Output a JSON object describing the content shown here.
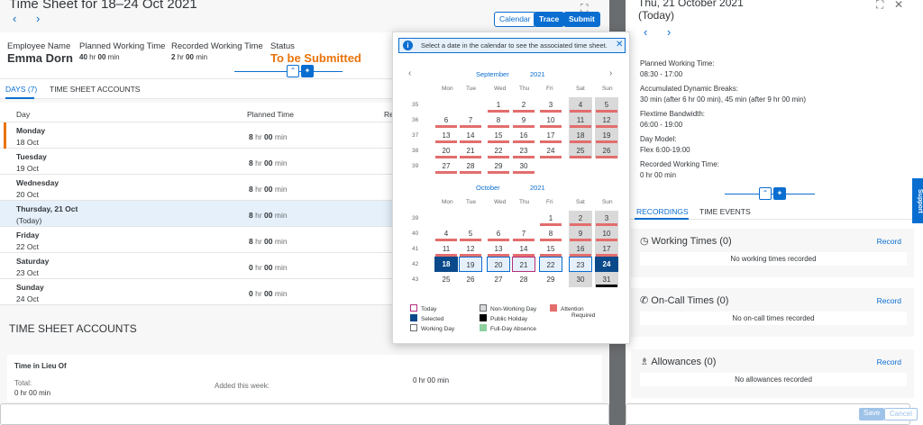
{
  "left": {
    "title": "Time Sheet for 18–24 Oct 2021",
    "nav_prev": "‹",
    "nav_next": "›",
    "expand_icon": "⛶",
    "buttons": {
      "calendar": "Calendar",
      "trace": "Trace",
      "submit": "Submit"
    },
    "header": {
      "employee_label": "Employee Name",
      "employee_name": "Emma Dorn",
      "planned_label": "Planned Working Time",
      "planned_hr": "40",
      "planned_min": "00",
      "recorded_label": "Recorded Working Time",
      "recorded_hr": "2",
      "recorded_min": "00",
      "status_label": "Status",
      "status_value": "To be Submitted",
      "collapse_icon": "⌃",
      "pin_icon": "📌"
    },
    "tabs": {
      "days": "DAYS (7)",
      "accounts": "TIME SHEET ACCOUNTS"
    },
    "table": {
      "col_day": "Day",
      "col_planned": "Planned Time",
      "col_recorded_partial": "Re",
      "hr_unit": "hr",
      "min_unit": "min",
      "rows": [
        {
          "name": "Monday",
          "date": "18 Oct",
          "hr": "8",
          "min": "00"
        },
        {
          "name": "Tuesday",
          "date": "19 Oct",
          "hr": "8",
          "min": "00"
        },
        {
          "name": "Wednesday",
          "date": "20 Oct",
          "hr": "8",
          "min": "00"
        },
        {
          "name": "Thursday, 21 Oct",
          "date": "(Today)",
          "hr": "8",
          "min": "00"
        },
        {
          "name": "Friday",
          "date": "22 Oct",
          "hr": "8",
          "min": "00"
        },
        {
          "name": "Saturday",
          "date": "23 Oct",
          "hr": "0",
          "min": "00"
        },
        {
          "name": "Sunday",
          "date": "24 Oct",
          "hr": "0",
          "min": "00"
        }
      ]
    },
    "accounts": {
      "title": "TIME SHEET ACCOUNTS",
      "til_title": "Time in Lieu Of",
      "total_label": "Total:",
      "total_value": "0 hr 00 min",
      "added_label": "Added this week:",
      "added_value": "0 hr 00 min"
    }
  },
  "right": {
    "title_line1": "Thu, 21 October 2021",
    "title_line2": "(Today)",
    "nav_prev": "‹",
    "nav_next": "›",
    "icons": {
      "expand": "⛶",
      "close": "✕"
    },
    "planned_label": "Planned Working Time:",
    "planned_value": "08:30 - 17:00",
    "breaks_label": "Accumulated Dynamic Breaks:",
    "breaks_value": "30 min (after 6 hr 00 min), 45 min (after 9 hr 00 min)",
    "flex_label": "Flextime Bandwidth:",
    "flex_value": "06:00 - 19:00",
    "model_label": "Day Model:",
    "model_value": "Flex 6:00-19:00",
    "recorded_label": "Recorded Working Time:",
    "recorded_value": "0 hr 00 min",
    "collapse_icon": "⌃",
    "pin_icon": "📌",
    "tabs": {
      "recordings": "RECORDINGS",
      "events": "TIME EVENTS"
    },
    "sections": [
      {
        "icon": "◷",
        "title": "Working Times (0)",
        "record": "Record",
        "empty": "No working times recorded"
      },
      {
        "icon": "✆",
        "title": "On-Call Times (0)",
        "record": "Record",
        "empty": "No on-call times recorded"
      },
      {
        "icon": "♗",
        "title": "Allowances (0)",
        "record": "Record",
        "empty": "No allowances recorded"
      }
    ],
    "support": "Support",
    "footer": {
      "save": "Save",
      "cancel": "Cancel"
    }
  },
  "popover": {
    "info_icon": "i",
    "info_text": "Select a date in the calendar to see the associated time sheet.",
    "info_close": "✕",
    "prev_icon": "‹",
    "next_icon": "›",
    "weekdays": [
      "Mon",
      "Tue",
      "Wed",
      "Thu",
      "Fri",
      "Sat",
      "Sun"
    ],
    "september": {
      "month": "September",
      "year": "2021",
      "weeks": [
        "35",
        "36",
        "37",
        "38",
        "39"
      ],
      "rows": [
        [
          "",
          "",
          "1",
          "2",
          "3",
          "4",
          "5"
        ],
        [
          "6",
          "7",
          "8",
          "9",
          "10",
          "11",
          "12"
        ],
        [
          "13",
          "14",
          "15",
          "16",
          "17",
          "18",
          "19"
        ],
        [
          "20",
          "21",
          "22",
          "23",
          "24",
          "25",
          "26"
        ],
        [
          "27",
          "28",
          "29",
          "30",
          "",
          "",
          ""
        ]
      ]
    },
    "october": {
      "month": "October",
      "year": "2021",
      "weeks": [
        "39",
        "40",
        "41",
        "42",
        "43"
      ],
      "rows": [
        [
          "",
          "",
          "",
          "",
          "1",
          "2",
          "3"
        ],
        [
          "4",
          "5",
          "6",
          "7",
          "8",
          "9",
          "10"
        ],
        [
          "11",
          "12",
          "13",
          "14",
          "15",
          "16",
          "17"
        ],
        [
          "18",
          "19",
          "20",
          "21",
          "22",
          "23",
          "24"
        ],
        [
          "25",
          "26",
          "27",
          "28",
          "29",
          "30",
          "31"
        ]
      ]
    },
    "legend": {
      "today": "Today",
      "selected": "Selected",
      "working": "Working Day",
      "nonworking": "Non-Working Day",
      "holiday": "Public Holiday",
      "absence": "Full-Day Absence",
      "attention_line1": "Attention",
      "attention_line2": "Required"
    },
    "colors": {
      "attention": "#e36d6d",
      "selected": "#0a4a8a",
      "today": "#b52e7e",
      "absence": "#8fd19e"
    }
  }
}
